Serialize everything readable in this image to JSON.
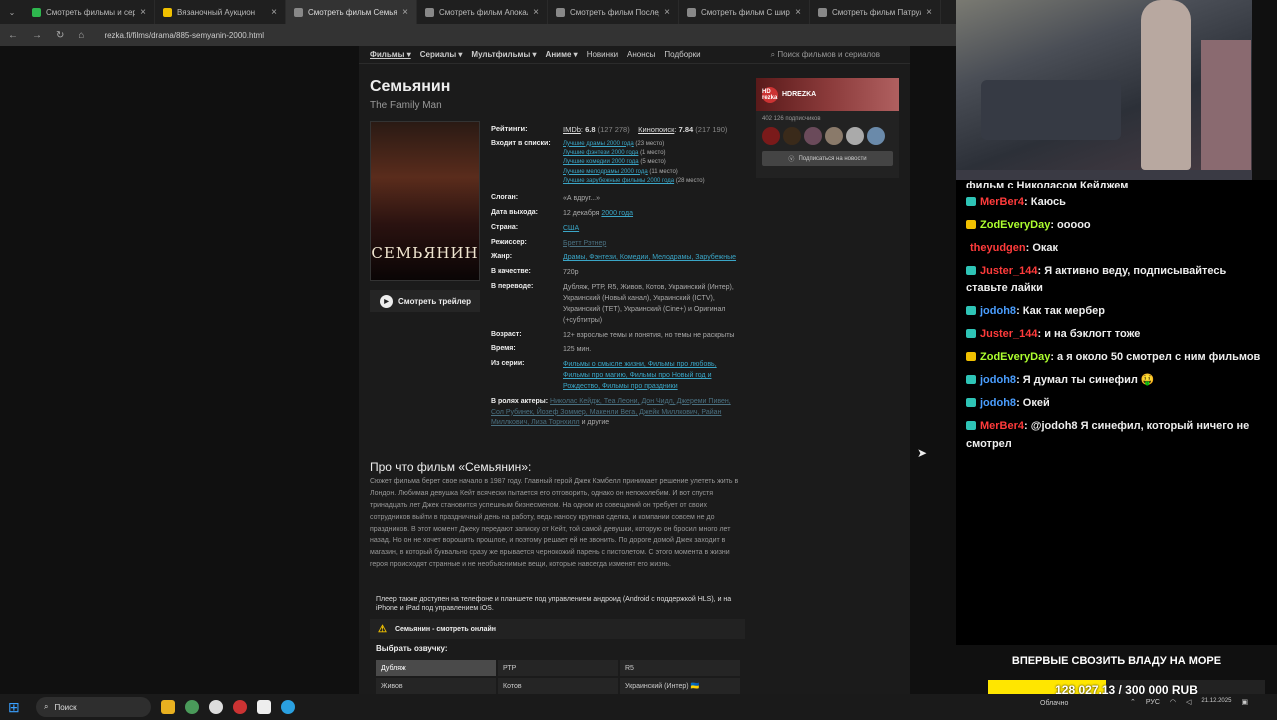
{
  "tabs": [
    {
      "title": "Смотреть фильмы и сериалы он",
      "color": "#2eb74e"
    },
    {
      "title": "Вязаночный Аукцион",
      "color": "#f0c000"
    },
    {
      "title": "Смотреть фильм Семьянин онл",
      "color": "#888888"
    },
    {
      "title": "Смотреть фильм Апокалипсис",
      "color": "#888888"
    },
    {
      "title": "Смотреть фильм Последний о",
      "color": "#888888"
    },
    {
      "title": "Смотреть фильм С широко за",
      "color": "#888888"
    },
    {
      "title": "Смотреть фильм Патруль вре",
      "color": "#888888"
    }
  ],
  "url": "rezka.fi/films/drama/885-semyanin-2000.html",
  "nav": {
    "films": "Фильмы",
    "series": "Сериалы",
    "cartoons": "Мультфильмы",
    "anime": "Аниме",
    "news": "Новинки",
    "announces": "Анонсы",
    "collections": "Подборки",
    "search_placeholder": "Поиск фильмов и сериалов"
  },
  "movie": {
    "title": "Семьянин",
    "original_title": "The Family Man",
    "poster_caption": "СЕМЬЯНИН",
    "trailer": "Смотреть трейлер",
    "labels": {
      "ratings": "Рейтинги:",
      "lists": "Входит в списки:",
      "slogan": "Слоган:",
      "release": "Дата выхода:",
      "country": "Страна:",
      "director": "Режиссер:",
      "genre": "Жанр:",
      "quality": "В качестве:",
      "translation": "В переводе:",
      "age": "Возраст:",
      "time": "Время:",
      "series": "Из серии:",
      "actors": "В ролях актеры:"
    },
    "imdb_label": "IMDb",
    "imdb": "6.8",
    "imdb_votes": "(127 278)",
    "kp_label": "Кинопоиск",
    "kp": "7.84",
    "kp_votes": "(217 190)",
    "lists": [
      {
        "name": "Лучшие драмы 2000 года",
        "place": "(23 место)"
      },
      {
        "name": "Лучшие фэнтези 2000 года",
        "place": "(1 место)"
      },
      {
        "name": "Лучшие комедии 2000 года",
        "place": "(5 место)"
      },
      {
        "name": "Лучшие мелодрамы 2000 года",
        "place": "(11 место)"
      },
      {
        "name": "Лучшие зарубежные фильмы 2000 года",
        "place": "(28 место)"
      }
    ],
    "slogan": "«А вдруг...»",
    "release_day": "12 декабря",
    "release_year": "2000 года",
    "country": "США",
    "director": "Бретт Рэтнер",
    "genre": "Драмы, Фэнтези, Комедии, Мелодрамы, Зарубежные",
    "quality": "720p",
    "translation": "Дубляж, РТР, R5, Живов, Котов, Украинский (Интер), Украинский (Новый канал), Украинский (ICTV), Украинский (ТЕТ), Украинский (Cine+) и Оригинал (+субтитры)",
    "age_num": "12+",
    "age_text": "взрослые темы и понятия, но темы не раскрыты",
    "time": "125 мин.",
    "series": "Фильмы о смысле жизни, Фильмы про любовь, Фильмы про магию, Фильмы про Новый год и Рождество, Фильмы про праздники",
    "actors": "Николас Кейдж, Теа Леони, Дон Чидл, Джереми Пивен, Сол Рубинек, Йозеф Зоммер, Макенли Вега, Джейк Миллкович, Райан Миллкович, Лиза Торнхилл",
    "actors_more": "и другие",
    "about_title": "Про что фильм «Семьянин»:",
    "description": "Сюжет фильма берет свое начало в 1987 году. Главный герой Джек Кэмбелл принимает решение улететь жить в Лондон. Любимая девушка Кейт всячески пытается его отговорить, однако он непоколебим. И вот спустя тринадцать лет Джек становится успешным бизнесменом. На одном из совещаний он требует от своих сотрудников выйти в праздничный день на работу, ведь наносу крупная сделка, и компании совсем не до праздников. В этот момент Джеку передают записку от Кейт, той самой девушки, которую он бросил много лет назад. Но он не хочет ворошить прошлое, и поэтому решает ей не звонить. По дороге домой Джек заходит в магазин, в который буквально сразу же врывается чернокожий парень с пистолетом. С этого момента в жизни героя происходят странные и не необъяснимые вещи, которые навсегда изменят его жизнь.",
    "player_note": "Плеер также доступен на телефоне и планшете под управлением андроид (Android с поддержкой HLS), и на iPhone и iPad под управлением iOS.",
    "watch_online": "Семьянин - смотреть онлайн",
    "choose_voice": "Выбрать озвучку:",
    "voices": [
      "Дубляж",
      "РТР",
      "R5",
      "Живов",
      "Котов",
      "Украинский (Интер) 🇺🇦"
    ]
  },
  "vk": {
    "name": "HDREZKA",
    "logo": "HD rezka",
    "subscribers": "402 126 подписчиков",
    "subscribe": "Подписаться на новости"
  },
  "chat": {
    "top_cut": "фильм с Николасом Кейджем",
    "messages": [
      {
        "user": "MerBer4",
        "color": "#ff3b3b",
        "badge": "#2ec4b6",
        "text": ": Каюсь"
      },
      {
        "user": "ZodEveryDay",
        "color": "#adff2f",
        "badge": "#f0c000",
        "text": ": ooooo"
      },
      {
        "user": "theyudgen",
        "color": "#ff3b3b",
        "badge": "",
        "text": ": Окак"
      },
      {
        "user": "Juster_144",
        "color": "#ff3b3b",
        "badge": "#2ec4b6",
        "text": ": Я активно веду, подписывайтесь ставьте лайки"
      },
      {
        "user": "jodoh8",
        "color": "#4a9eff",
        "badge": "#2ec4b6",
        "text": ": Как так мербер"
      },
      {
        "user": "Juster_144",
        "color": "#ff3b3b",
        "badge": "#2ec4b6",
        "text": ": и на бэклогт тоже"
      },
      {
        "user": "ZodEveryDay",
        "color": "#adff2f",
        "badge": "#f0c000",
        "text": ": а я около 50 смотрел с ним фильмов"
      },
      {
        "user": "jodoh8",
        "color": "#4a9eff",
        "badge": "#2ec4b6",
        "text": ": Я думал ты синефил 🤑"
      },
      {
        "user": "jodoh8",
        "color": "#4a9eff",
        "badge": "#2ec4b6",
        "text": ": Окей"
      },
      {
        "user": "MerBer4",
        "color": "#ff3b3b",
        "badge": "#2ec4b6",
        "text": ": @jodoh8 Я синефил, который ничего не смотрел"
      }
    ]
  },
  "donation": {
    "title": "ВПЕРВЫЕ СВОЗИТЬ ВЛАДУ НА МОРЕ",
    "amount": "128 027.13 / 300 000 RUB",
    "progress": 0.4268
  },
  "taskbar": {
    "search": "Поиск",
    "weather": "Облачно",
    "lang": "РУС",
    "date": "21.12.2025"
  }
}
